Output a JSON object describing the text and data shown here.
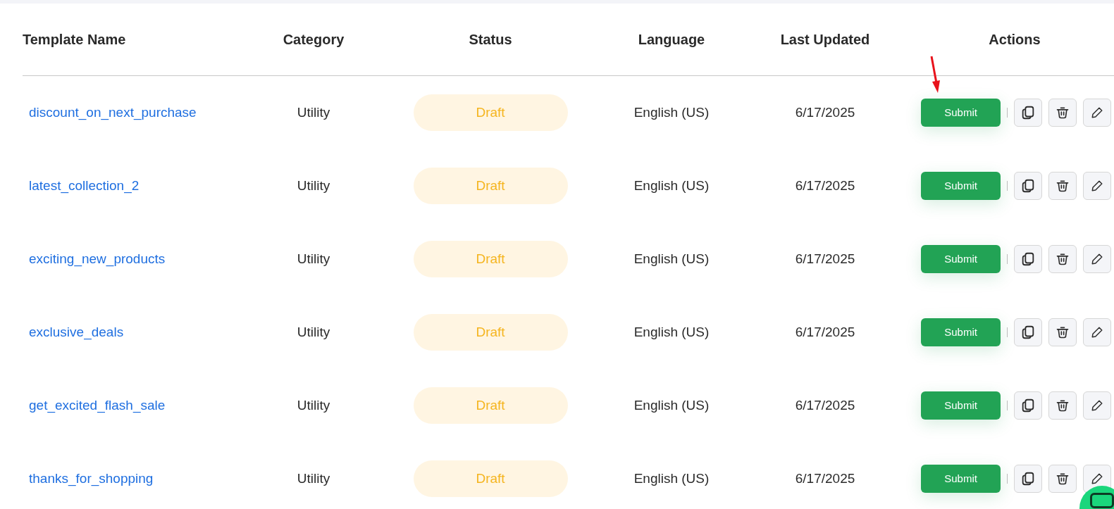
{
  "table": {
    "columns": [
      "Template Name",
      "Category",
      "Status",
      "Language",
      "Last Updated",
      "Actions"
    ],
    "rows": [
      {
        "name": "discount_on_next_purchase",
        "category": "Utility",
        "status": "Draft",
        "language": "English (US)",
        "updated": "6/17/2025",
        "action": "Submit"
      },
      {
        "name": "latest_collection_2",
        "category": "Utility",
        "status": "Draft",
        "language": "English (US)",
        "updated": "6/17/2025",
        "action": "Submit"
      },
      {
        "name": "exciting_new_products",
        "category": "Utility",
        "status": "Draft",
        "language": "English (US)",
        "updated": "6/17/2025",
        "action": "Submit"
      },
      {
        "name": "exclusive_deals",
        "category": "Utility",
        "status": "Draft",
        "language": "English (US)",
        "updated": "6/17/2025",
        "action": "Submit"
      },
      {
        "name": "get_excited_flash_sale",
        "category": "Utility",
        "status": "Draft",
        "language": "English (US)",
        "updated": "6/17/2025",
        "action": "Submit"
      },
      {
        "name": "thanks_for_shopping",
        "category": "Utility",
        "status": "Draft",
        "language": "English (US)",
        "updated": "6/17/2025",
        "action": "Submit"
      }
    ]
  }
}
